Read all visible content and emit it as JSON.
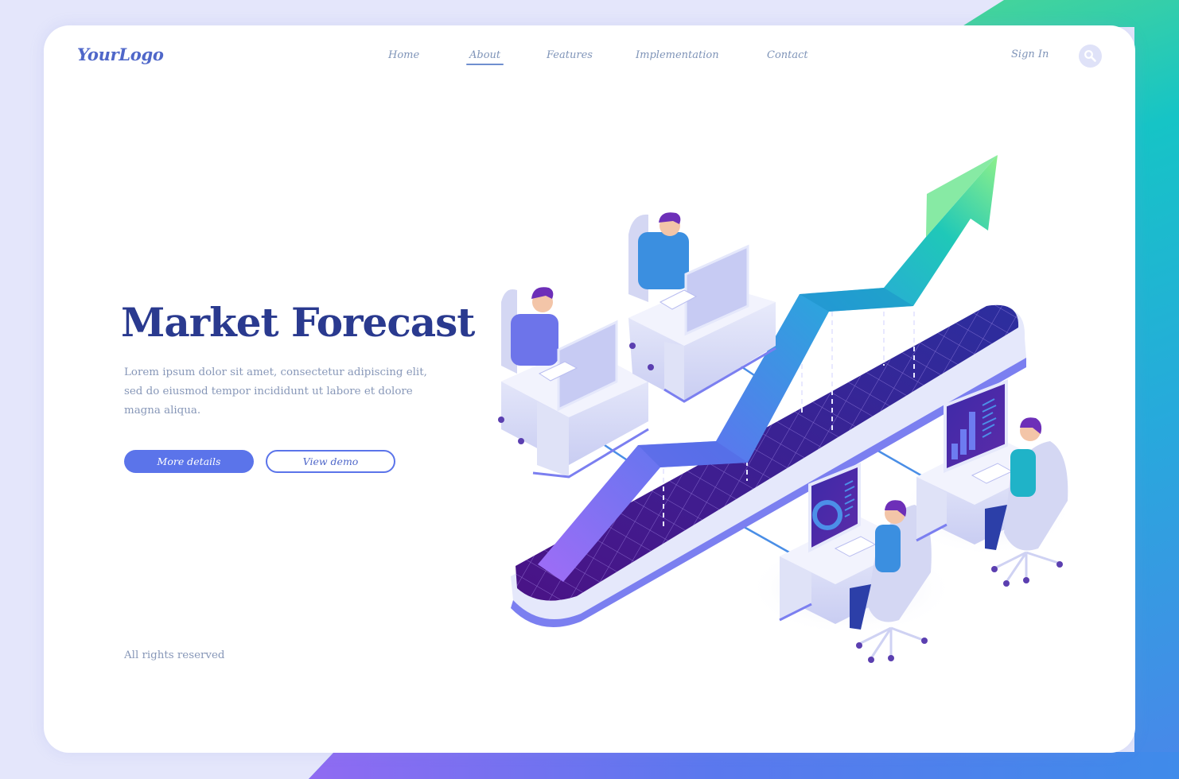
{
  "header": {
    "logo": "YourLogo",
    "nav": [
      {
        "label": "Home",
        "active": false
      },
      {
        "label": "About",
        "active": true
      },
      {
        "label": "Features",
        "active": false
      },
      {
        "label": "Implementation",
        "active": false
      },
      {
        "label": "Contact",
        "active": false
      }
    ],
    "sign_in": "Sign In",
    "search_icon": "search-icon"
  },
  "hero": {
    "title": "Market Forecast",
    "description": "Lorem ipsum dolor sit amet, consectetur adipiscing elit, sed do eiusmod tempor incididunt ut labore et dolore magna aliqua.",
    "primary_button": "More details",
    "secondary_button": "View demo"
  },
  "footer": {
    "text": "All rights reserved"
  },
  "illustration": {
    "subject": "isometric growth chart arrow on grid platform with four people working at computer desks",
    "monitor_screens": [
      "bar-chart",
      "donut-chart"
    ]
  },
  "colors": {
    "brand": "#4f67c9",
    "title": "#2a3a8f",
    "primary_button": "#5b74ea",
    "muted_text": "#8797b8",
    "nav_text": "#7f94b8",
    "arrow_start": "#9a6cf5",
    "arrow_end": "#8ef08a",
    "grid": "#3a1f9a"
  }
}
